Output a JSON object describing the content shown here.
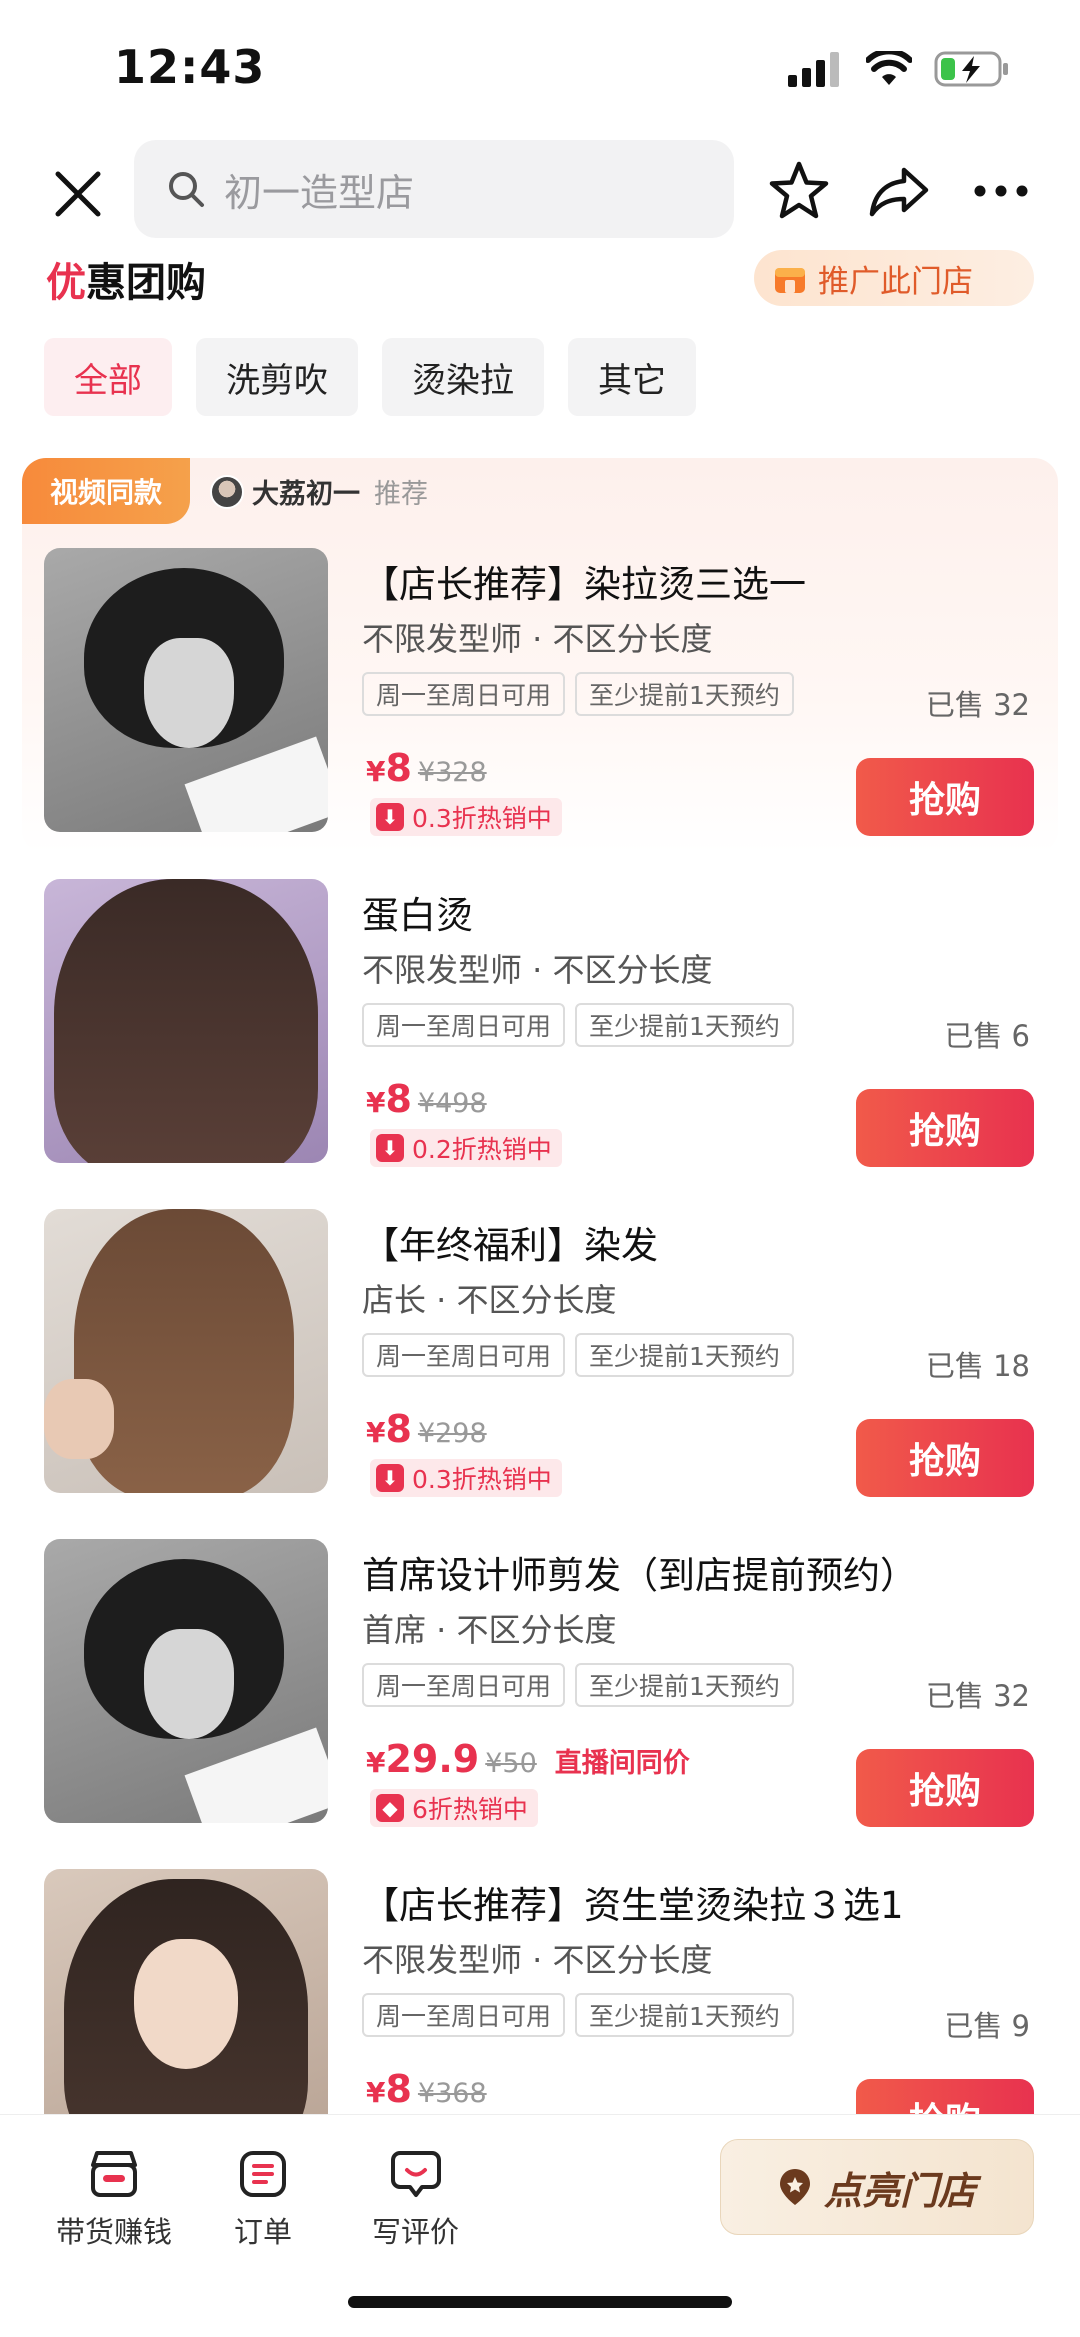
{
  "status": {
    "time": "12:43"
  },
  "search": {
    "placeholder": "初一造型店"
  },
  "section": {
    "title_first": "优",
    "title_rest": "惠团购",
    "promote_label": "推广此门店"
  },
  "chips": [
    "全部",
    "洗剪吹",
    "烫染拉",
    "其它"
  ],
  "featured": {
    "video_tag": "视频同款",
    "recommender_name": "大荔初一",
    "recommender_tag": "推荐"
  },
  "items": [
    {
      "title": "【店长推荐】染拉烫三选一",
      "subtitle": "不限发型师 · 不区分长度",
      "tag1": "周一至周日可用",
      "tag2": "至少提前1天预约",
      "sold": "已售 32",
      "yen": "¥",
      "price": "8",
      "orig": "¥328",
      "live_note": "",
      "discount": "0.3折热销中",
      "buy": "抢购"
    },
    {
      "title": "蛋白烫",
      "subtitle": "不限发型师 · 不区分长度",
      "tag1": "周一至周日可用",
      "tag2": "至少提前1天预约",
      "sold": "已售 6",
      "yen": "¥",
      "price": "8",
      "orig": "¥498",
      "live_note": "",
      "discount": "0.2折热销中",
      "buy": "抢购"
    },
    {
      "title": "【年终福利】染发",
      "subtitle": "店长 · 不区分长度",
      "tag1": "周一至周日可用",
      "tag2": "至少提前1天预约",
      "sold": "已售 18",
      "yen": "¥",
      "price": "8",
      "orig": "¥298",
      "live_note": "",
      "discount": "0.3折热销中",
      "buy": "抢购"
    },
    {
      "title": "首席设计师剪发（到店提前预约）",
      "subtitle": "首席 · 不区分长度",
      "tag1": "周一至周日可用",
      "tag2": "至少提前1天预约",
      "sold": "已售 32",
      "yen": "¥",
      "price": "29.9",
      "orig": "¥50",
      "live_note": "直播间同价",
      "discount": "6折热销中",
      "buy": "抢购"
    },
    {
      "title": "【店长推荐】资生堂烫染拉３选1",
      "subtitle": "不限发型师 · 不区分长度",
      "tag1": "周一至周日可用",
      "tag2": "至少提前1天预约",
      "sold": "已售 9",
      "yen": "¥",
      "price": "8",
      "orig": "¥368",
      "live_note": "",
      "discount": "",
      "buy": "抢购"
    }
  ],
  "bottom": {
    "tab1": "带货赚钱",
    "tab2": "订单",
    "tab3": "写评价",
    "light": "点亮门店"
  },
  "colors": {
    "accent": "#e8324f",
    "orange": "#f78a3b",
    "brown": "#6b3a1e"
  }
}
